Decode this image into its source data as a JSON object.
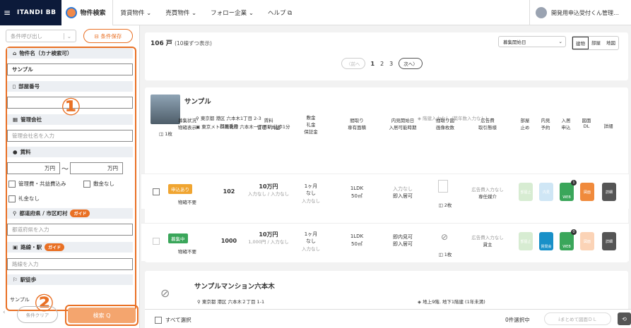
{
  "topbar": {
    "menu_icon": "≡",
    "brand": "ITANDI BB",
    "active_tab": "物件検索",
    "nav": [
      "賃貸物件 ⌄",
      "売買物件 ⌄",
      "フォロー企業 ⌄",
      "ヘルプ ⧉"
    ],
    "user": "開発用申込受付くん管理…"
  },
  "sidebar": {
    "preset_select": "条件呼び出し",
    "preset_save": "⊟ 条件保存",
    "property_name_label": "物件名（カナ検索可）",
    "property_name_value": "サンプル",
    "room_number_label": "部屋番号",
    "management_label": "管理会社",
    "management_placeholder": "管理会社名を入力",
    "rent_label": "賃料",
    "rent_min": "万円",
    "rent_max": "万円",
    "rent_sep": "〜",
    "checkbox_mgmt": "管理費・共益費込み",
    "checkbox_deposit": "敷金なし",
    "checkbox_key": "礼金なし",
    "pref_label": "都道府県 / 市区町村",
    "guide": "ガイド",
    "pref_placeholder": "都道府県を入力",
    "line_label": "路線・駅",
    "line_guide": "ガイド",
    "line_placeholder": "路線を入力",
    "walk_label": "駅徒歩",
    "annotation_1": "①",
    "annotation_2": "②",
    "bottom_text": "サンプル",
    "search": "検索 Q",
    "clear": "条件クリア"
  },
  "results": {
    "count": "106 戸",
    "count_sub": "(10棟ずつ表示)",
    "sort": "募集開始日",
    "view_tabs": [
      "建物",
      "部屋",
      "地図"
    ],
    "pagination": {
      "prev": "〈前へ",
      "pages": [
        "1",
        "2",
        "3"
      ],
      "next": "次へ〉"
    }
  },
  "building1": {
    "name": "サンプル",
    "address": "東京都 港区 六本木1丁目 2-3",
    "station": "東京メトロ南北線 六本木一丁目駅 徒歩1分",
    "floors": "階建入力なし (築年数入力なし)",
    "photos": "1枚"
  },
  "columns": [
    "募集状況\n物確表示",
    "部屋番号",
    "賃料\n管理・共益",
    "敷金\n礼金\n保証金",
    "間取り\n専有面積",
    "内見開始日\n入居可能時期",
    "間取り図\n画像枚数",
    "広告費\n取引態様",
    "部屋\n止め",
    "内見\n予約",
    "入居\n申込",
    "図面\nDL",
    "詳細"
  ],
  "rows": [
    {
      "status": "申込あり",
      "status_color": "#f0a531",
      "sub": "物確不要",
      "room": "102",
      "rent": "10万円",
      "fee": "入力なし / 入力なし",
      "deposit": "1ヶ月",
      "key": "なし",
      "guarantee": "入力なし",
      "layout": "1LDK",
      "area": "50㎡",
      "view": "入力なし",
      "move": "即入居可",
      "images": "2枚",
      "ad": "広告費入力なし",
      "deal": "専任媒介",
      "badge": "1"
    },
    {
      "status": "募集中",
      "status_color": "#3aa65a",
      "sub": "物確不要",
      "room": "1000",
      "rent": "10万円",
      "fee": "1,000円 / 入力なし",
      "deposit": "1ヶ月",
      "key": "なし",
      "guarantee": "入力なし",
      "layout": "1LDK",
      "area": "50㎡",
      "view": "即内見可",
      "move": "即入居可",
      "images": "1枚",
      "ad": "広告費入力なし",
      "deal": "貸主",
      "badge": "0"
    }
  ],
  "buttons": {
    "stop": "部屋止",
    "web": "WEB",
    "view_btn": "内見",
    "zumen": "図面",
    "detail": "詳細",
    "consult": "質問会"
  },
  "building2": {
    "name": "サンプルマンション六本木",
    "address": "東京都 港区 六本木２丁目 1-1",
    "floors": "地上9階, 地下1階建 (1年未満)"
  },
  "footer": {
    "select_all": "すべて選択",
    "selected": "0件選択中",
    "bulk": "まとめて図面ＤＬ"
  }
}
